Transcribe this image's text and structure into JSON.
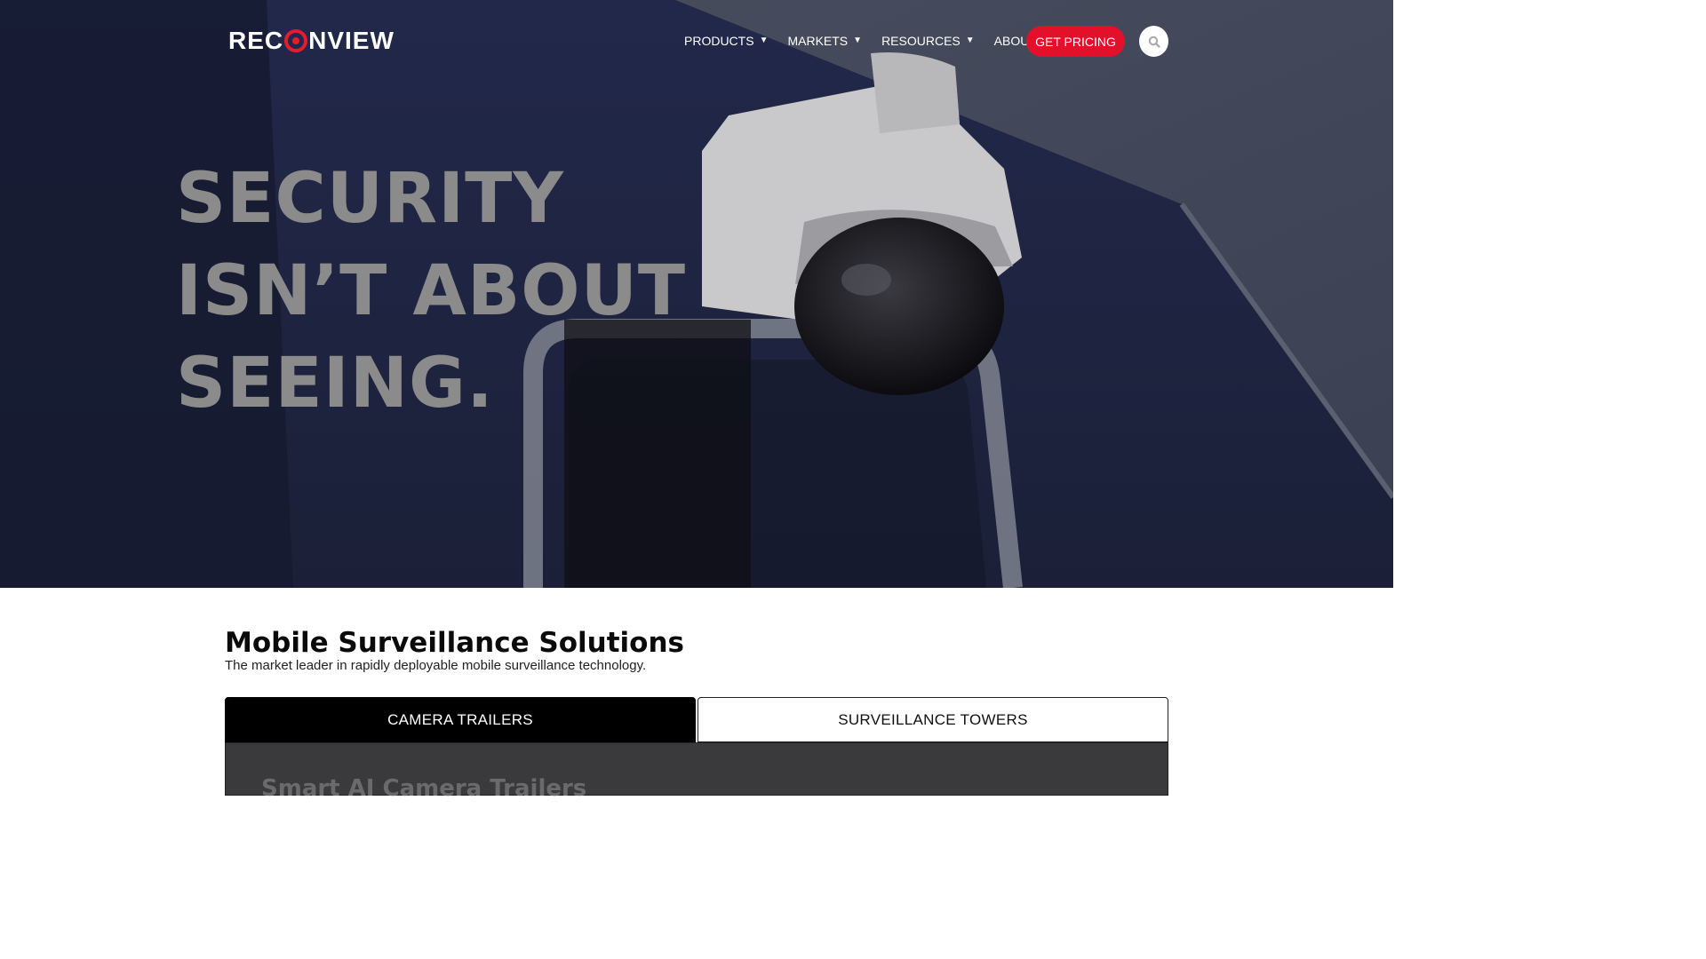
{
  "brand": {
    "logo_left": "REC",
    "logo_right": "NVIEW",
    "accent_color": "#e3102b"
  },
  "nav": {
    "items": [
      {
        "label": "PRODUCTS",
        "icon": "chevron-down-icon"
      },
      {
        "label": "MARKETS",
        "icon": "chevron-down-icon"
      },
      {
        "label": "RESOURCES",
        "icon": "chevron-down-icon"
      },
      {
        "label": "ABOUT",
        "icon": "chevron-down-icon"
      }
    ],
    "cta_label": "GET PRICING",
    "search_icon": "search-icon"
  },
  "hero": {
    "headline_lines": [
      "SECURITY",
      "ISN’T ABOUT",
      "SEEING."
    ]
  },
  "section": {
    "title": "Mobile Surveillance Solutions",
    "subtitle": "The market leader in rapidly deployable mobile surveillance technology."
  },
  "tabs": [
    {
      "label": "CAMERA TRAILERS",
      "active": true
    },
    {
      "label": "SURVEILLANCE TOWERS",
      "active": false
    }
  ],
  "panel": {
    "heading": "Smart AI Camera Trailers"
  }
}
